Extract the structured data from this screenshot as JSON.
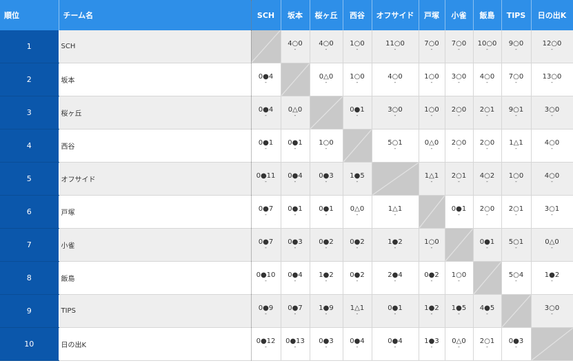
{
  "header": {
    "rank_label": "順位",
    "team_label": "チーム名",
    "columns": [
      "SCH",
      "坂本",
      "桜ヶ丘",
      "西谷",
      "オフサイド",
      "戸塚",
      "小雀",
      "飯島",
      "TIPS",
      "日の出K"
    ]
  },
  "rows": [
    {
      "rank": "1",
      "team": "SCH",
      "cells": [
        "",
        "4○0",
        "4○0",
        "1○0",
        "11○0",
        "7○0",
        "7○0",
        "10○0",
        "9○0",
        "12○0"
      ]
    },
    {
      "rank": "2",
      "team": "坂本",
      "cells": [
        "0●4",
        "",
        "0△0",
        "1○0",
        "4○0",
        "1○0",
        "3○0",
        "4○0",
        "7○0",
        "13○0"
      ]
    },
    {
      "rank": "3",
      "team": "桜ヶ丘",
      "cells": [
        "0●4",
        "0△0",
        "",
        "0●1",
        "3○0",
        "1○0",
        "2○0",
        "2○1",
        "9○1",
        "3○0"
      ]
    },
    {
      "rank": "4",
      "team": "西谷",
      "cells": [
        "0●1",
        "0●1",
        "1○0",
        "",
        "5○1",
        "0△0",
        "2○0",
        "2○0",
        "1△1",
        "4○0"
      ]
    },
    {
      "rank": "5",
      "team": "オフサイド",
      "cells": [
        "0●11",
        "0●4",
        "0●3",
        "1●5",
        "",
        "1△1",
        "2○1",
        "4○2",
        "1○0",
        "4○0"
      ]
    },
    {
      "rank": "6",
      "team": "戸塚",
      "cells": [
        "0●7",
        "0●1",
        "0●1",
        "0△0",
        "1△1",
        "",
        "0●1",
        "2○0",
        "2○1",
        "3○1"
      ]
    },
    {
      "rank": "7",
      "team": "小雀",
      "cells": [
        "0●7",
        "0●3",
        "0●2",
        "0●2",
        "1●2",
        "1○0",
        "",
        "0●1",
        "5○1",
        "0△0"
      ]
    },
    {
      "rank": "8",
      "team": "飯島",
      "cells": [
        "0●10",
        "0●4",
        "1●2",
        "0●2",
        "2●4",
        "0●2",
        "1○0",
        "",
        "5○4",
        "1●2"
      ]
    },
    {
      "rank": "9",
      "team": "TIPS",
      "cells": [
        "0●9",
        "0●7",
        "1●9",
        "1△1",
        "0●1",
        "1●2",
        "1●5",
        "4●5",
        "",
        "3○0"
      ]
    },
    {
      "rank": "10",
      "team": "日の出K",
      "cells": [
        "0●12",
        "0●13",
        "0●3",
        "0●4",
        "0●4",
        "1●3",
        "0△0",
        "2○1",
        "0●3",
        ""
      ]
    }
  ],
  "sub_mark": "-",
  "colors": {
    "header_bg": "#2e8fe8",
    "rank_bg": "#0b57ab",
    "diagonal_bg": "#c9c9c9",
    "stripe_bg": "#eeeeee"
  }
}
